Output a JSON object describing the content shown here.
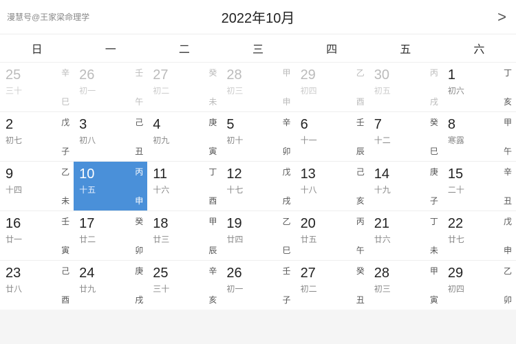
{
  "header": {
    "logo": "漫慧号@王家梁命理学",
    "title": "2022年10月",
    "arrow": ">"
  },
  "weekdays": [
    "日",
    "一",
    "二",
    "三",
    "四",
    "五",
    "六"
  ],
  "weeks": [
    [
      {
        "num": "25",
        "gz_top": "辛",
        "lunar": "三十",
        "gz_bot": "巳",
        "other": true,
        "today": false,
        "solar_term": ""
      },
      {
        "num": "26",
        "gz_top": "壬",
        "lunar": "初一",
        "gz_bot": "午",
        "other": true,
        "today": false,
        "solar_term": ""
      },
      {
        "num": "27",
        "gz_top": "癸",
        "lunar": "初二",
        "gz_bot": "未",
        "other": true,
        "today": false,
        "solar_term": ""
      },
      {
        "num": "28",
        "gz_top": "甲",
        "lunar": "初三",
        "gz_bot": "申",
        "other": true,
        "today": false,
        "solar_term": ""
      },
      {
        "num": "29",
        "gz_top": "乙",
        "lunar": "初四",
        "gz_bot": "酉",
        "other": true,
        "today": false,
        "solar_term": ""
      },
      {
        "num": "30",
        "gz_top": "丙",
        "lunar": "初五",
        "gz_bot": "戌",
        "other": true,
        "today": false,
        "solar_term": ""
      },
      {
        "num": "1",
        "gz_top": "丁",
        "lunar": "初六",
        "gz_bot": "亥",
        "other": false,
        "today": false,
        "solar_term": ""
      }
    ],
    [
      {
        "num": "2",
        "gz_top": "戊",
        "lunar": "初七",
        "gz_bot": "子",
        "other": false,
        "today": false,
        "solar_term": ""
      },
      {
        "num": "3",
        "gz_top": "己",
        "lunar": "初八",
        "gz_bot": "丑",
        "other": false,
        "today": false,
        "solar_term": ""
      },
      {
        "num": "4",
        "gz_top": "庚",
        "lunar": "初九",
        "gz_bot": "寅",
        "other": false,
        "today": false,
        "solar_term": ""
      },
      {
        "num": "5",
        "gz_top": "辛",
        "lunar": "初十",
        "gz_bot": "卯",
        "other": false,
        "today": false,
        "solar_term": ""
      },
      {
        "num": "6",
        "gz_top": "壬",
        "lunar": "十一",
        "gz_bot": "辰",
        "other": false,
        "today": false,
        "solar_term": ""
      },
      {
        "num": "7",
        "gz_top": "癸",
        "lunar": "十二",
        "gz_bot": "巳",
        "other": false,
        "today": false,
        "solar_term": ""
      },
      {
        "num": "8",
        "gz_top": "甲",
        "lunar": "寒露",
        "gz_bot": "午",
        "other": false,
        "today": false,
        "solar_term": "寒露"
      }
    ],
    [
      {
        "num": "9",
        "gz_top": "乙",
        "lunar": "十四",
        "gz_bot": "未",
        "other": false,
        "today": false,
        "solar_term": ""
      },
      {
        "num": "10",
        "gz_top": "丙",
        "lunar": "十五",
        "gz_bot": "申",
        "other": false,
        "today": true,
        "solar_term": ""
      },
      {
        "num": "11",
        "gz_top": "丁",
        "lunar": "十六",
        "gz_bot": "酉",
        "other": false,
        "today": false,
        "solar_term": ""
      },
      {
        "num": "12",
        "gz_top": "戊",
        "lunar": "十七",
        "gz_bot": "戌",
        "other": false,
        "today": false,
        "solar_term": ""
      },
      {
        "num": "13",
        "gz_top": "己",
        "lunar": "十八",
        "gz_bot": "亥",
        "other": false,
        "today": false,
        "solar_term": ""
      },
      {
        "num": "14",
        "gz_top": "庚",
        "lunar": "十九",
        "gz_bot": "子",
        "other": false,
        "today": false,
        "solar_term": ""
      },
      {
        "num": "15",
        "gz_top": "辛",
        "lunar": "二十",
        "gz_bot": "丑",
        "other": false,
        "today": false,
        "solar_term": ""
      }
    ],
    [
      {
        "num": "16",
        "gz_top": "壬",
        "lunar": "廿一",
        "gz_bot": "寅",
        "other": false,
        "today": false,
        "solar_term": ""
      },
      {
        "num": "17",
        "gz_top": "癸",
        "lunar": "廿二",
        "gz_bot": "卯",
        "other": false,
        "today": false,
        "solar_term": ""
      },
      {
        "num": "18",
        "gz_top": "甲",
        "lunar": "廿三",
        "gz_bot": "辰",
        "other": false,
        "today": false,
        "solar_term": ""
      },
      {
        "num": "19",
        "gz_top": "乙",
        "lunar": "廿四",
        "gz_bot": "巳",
        "other": false,
        "today": false,
        "solar_term": ""
      },
      {
        "num": "20",
        "gz_top": "丙",
        "lunar": "廿五",
        "gz_bot": "午",
        "other": false,
        "today": false,
        "solar_term": ""
      },
      {
        "num": "21",
        "gz_top": "丁",
        "lunar": "廿六",
        "gz_bot": "未",
        "other": false,
        "today": false,
        "solar_term": ""
      },
      {
        "num": "22",
        "gz_top": "戊",
        "lunar": "廿七",
        "gz_bot": "申",
        "other": false,
        "today": false,
        "solar_term": ""
      }
    ],
    [
      {
        "num": "23",
        "gz_top": "己",
        "lunar": "廿八",
        "gz_bot": "酉",
        "other": false,
        "today": false,
        "solar_term": ""
      },
      {
        "num": "24",
        "gz_top": "庚",
        "lunar": "廿九",
        "gz_bot": "戌",
        "other": false,
        "today": false,
        "solar_term": ""
      },
      {
        "num": "25",
        "gz_top": "辛",
        "lunar": "三十",
        "gz_bot": "亥",
        "other": false,
        "today": false,
        "solar_term": ""
      },
      {
        "num": "26",
        "gz_top": "壬",
        "lunar": "初一",
        "gz_bot": "子",
        "other": false,
        "today": false,
        "solar_term": ""
      },
      {
        "num": "27",
        "gz_top": "癸",
        "lunar": "初二",
        "gz_bot": "丑",
        "other": false,
        "today": false,
        "solar_term": ""
      },
      {
        "num": "28",
        "gz_top": "甲",
        "lunar": "初三",
        "gz_bot": "寅",
        "other": false,
        "today": false,
        "solar_term": ""
      },
      {
        "num": "29",
        "gz_top": "乙",
        "lunar": "初四",
        "gz_bot": "卯",
        "other": false,
        "today": false,
        "solar_term": ""
      }
    ]
  ]
}
